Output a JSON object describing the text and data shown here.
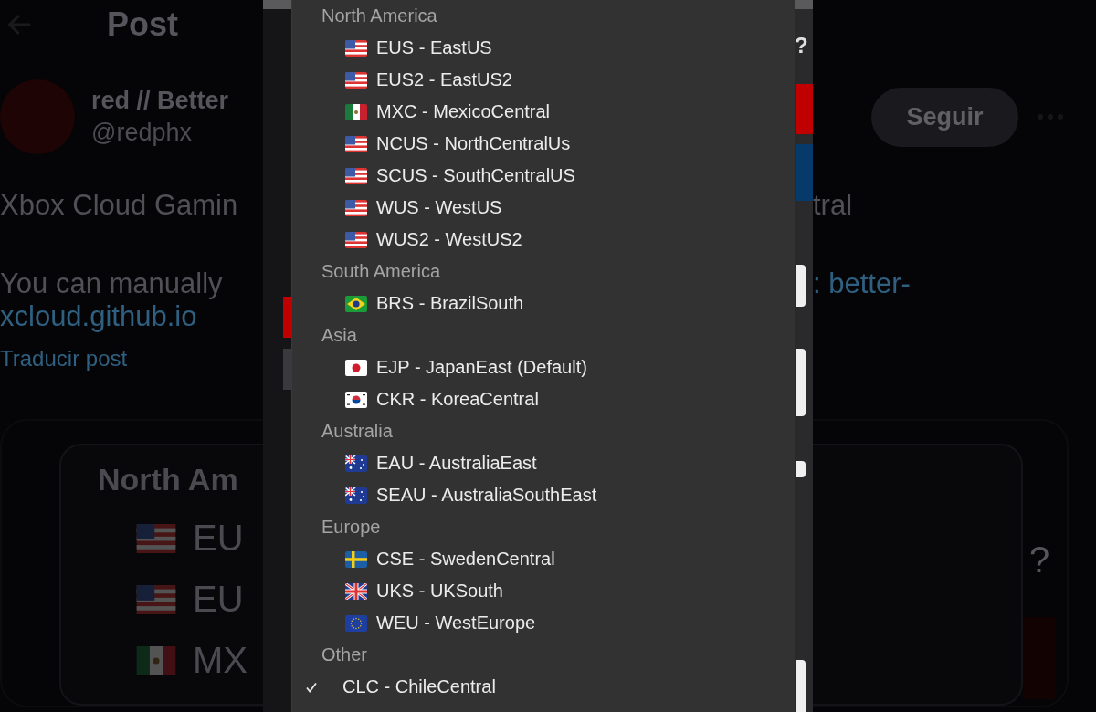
{
  "header": {
    "title": "Post"
  },
  "author": {
    "name": "red // Better",
    "handle": "@redphx",
    "follow_button": "Seguir"
  },
  "post": {
    "line_1_left": "Xbox Cloud Gamin",
    "line_1_right": "tral",
    "line_2_left": "You can manually",
    "line_2_right": ": better-",
    "link_continued": "xcloud.github.io",
    "translate_link": "Traducir post"
  },
  "embedded_image": {
    "heading": "North Am",
    "rows": [
      {
        "label": "EU",
        "kind": "us"
      },
      {
        "label": "EU",
        "kind": "us"
      },
      {
        "label": "MX",
        "kind": "mx"
      }
    ],
    "help_mark": "?"
  },
  "settings_panel": {
    "help_mark": "?"
  },
  "region_menu": {
    "groups": [
      {
        "label": "North America",
        "items": [
          {
            "label": "EUS - EastUS",
            "kind": "us",
            "selected": false
          },
          {
            "label": "EUS2 - EastUS2",
            "kind": "us",
            "selected": false
          },
          {
            "label": "MXC - MexicoCentral",
            "kind": "mx",
            "selected": false
          },
          {
            "label": "NCUS - NorthCentralUs",
            "kind": "us",
            "selected": false
          },
          {
            "label": "SCUS - SouthCentralUS",
            "kind": "us",
            "selected": false
          },
          {
            "label": "WUS - WestUS",
            "kind": "us",
            "selected": false
          },
          {
            "label": "WUS2 - WestUS2",
            "kind": "us",
            "selected": false
          }
        ]
      },
      {
        "label": "South America",
        "items": [
          {
            "label": "BRS - BrazilSouth",
            "kind": "br",
            "selected": false
          }
        ]
      },
      {
        "label": "Asia",
        "items": [
          {
            "label": "EJP - JapanEast (Default)",
            "kind": "jp",
            "selected": false
          },
          {
            "label": "CKR - KoreaCentral",
            "kind": "kr",
            "selected": false
          }
        ]
      },
      {
        "label": "Australia",
        "items": [
          {
            "label": "EAU - AustraliaEast",
            "kind": "au",
            "selected": false
          },
          {
            "label": "SEAU - AustraliaSouthEast",
            "kind": "au",
            "selected": false
          }
        ]
      },
      {
        "label": "Europe",
        "items": [
          {
            "label": "CSE - SwedenCentral",
            "kind": "se",
            "selected": false
          },
          {
            "label": "UKS - UKSouth",
            "kind": "gb",
            "selected": false
          },
          {
            "label": "WEU - WestEurope",
            "kind": "eu",
            "selected": false
          }
        ]
      },
      {
        "label": "Other",
        "items": [
          {
            "label": "CLC - ChileCentral",
            "selected": true
          }
        ]
      }
    ]
  }
}
